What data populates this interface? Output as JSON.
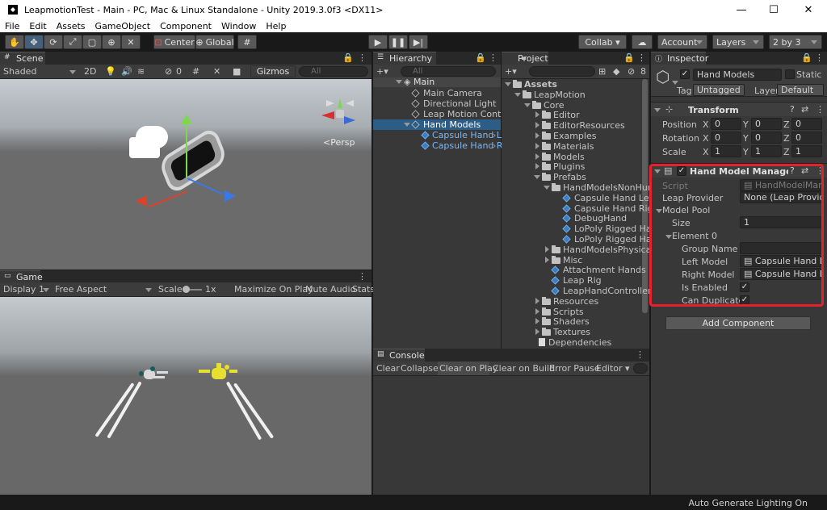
{
  "window": {
    "title": "LeapmotionTest - Main - PC, Mac & Linux Standalone - Unity 2019.3.0f3 <DX11>",
    "minimize": "—",
    "maximize": "☐",
    "close": "✕"
  },
  "menu": [
    "File",
    "Edit",
    "Assets",
    "GameObject",
    "Component",
    "Window",
    "Help"
  ],
  "toolbar": {
    "center": "Center",
    "global": "Global",
    "collab": "Collab ▾",
    "account": "Account",
    "layers": "Layers",
    "layout": "2 by 3"
  },
  "scene": {
    "tab": "Scene",
    "shading": "Shaded",
    "mode2d": "2D",
    "fx_count": "0",
    "gizmos": "Gizmos",
    "search_placeholder": "All",
    "persp": "<Persp"
  },
  "game": {
    "tab": "Game",
    "display": "Display 1",
    "aspect": "Free Aspect",
    "scale_label": "Scale",
    "scale_value": "1x",
    "maximize": "Maximize On Play",
    "mute": "Mute Audio",
    "stats": "Stats"
  },
  "hierarchy": {
    "tab": "Hierarchy",
    "add": "+▾",
    "search_placeholder": "All",
    "items": [
      {
        "label": "Main"
      },
      {
        "label": "Main Camera"
      },
      {
        "label": "Directional Light"
      },
      {
        "label": "Leap Motion Controlle"
      },
      {
        "label": "Hand Models"
      },
      {
        "label": "Capsule Hand Le"
      },
      {
        "label": "Capsule Hand R"
      }
    ]
  },
  "project": {
    "tab": "Project",
    "add": "+▾",
    "hidden_count": "8",
    "items": [
      {
        "label": "Assets"
      },
      {
        "label": "LeapMotion"
      },
      {
        "label": "Core"
      },
      {
        "label": "Editor"
      },
      {
        "label": "EditorResources"
      },
      {
        "label": "Examples"
      },
      {
        "label": "Materials"
      },
      {
        "label": "Models"
      },
      {
        "label": "Plugins"
      },
      {
        "label": "Prefabs"
      },
      {
        "label": "HandModelsNonHuma"
      },
      {
        "label": "Capsule Hand Left"
      },
      {
        "label": "Capsule Hand Right"
      },
      {
        "label": "DebugHand"
      },
      {
        "label": "LoPoly Rigged Hand"
      },
      {
        "label": "LoPoly Rigged Hand"
      },
      {
        "label": "HandModelsPhysical"
      },
      {
        "label": "Misc"
      },
      {
        "label": "Attachment Hands"
      },
      {
        "label": "Leap Rig"
      },
      {
        "label": "LeapHandController"
      },
      {
        "label": "Resources"
      },
      {
        "label": "Scripts"
      },
      {
        "label": "Shaders"
      },
      {
        "label": "Textures"
      },
      {
        "label": "Dependencies"
      }
    ]
  },
  "console": {
    "tab": "Console",
    "buttons": [
      "Clear",
      "Collapse",
      "Clear on Play",
      "Clear on Build",
      "Error Pause",
      "Editor ▾"
    ]
  },
  "inspector": {
    "tab": "Inspector",
    "object_name": "Hand Models",
    "static_label": "Static",
    "tag_label": "Tag",
    "tag_value": "Untagged",
    "layer_label": "Layer",
    "layer_value": "Default",
    "transform": {
      "title": "Transform",
      "position_label": "Position",
      "rotation_label": "Rotation",
      "scale_label": "Scale",
      "x": "X",
      "y": "Y",
      "z": "Z",
      "position": [
        "0",
        "0",
        "0"
      ],
      "rotation": [
        "0",
        "0",
        "0"
      ],
      "scale": [
        "1",
        "1",
        "1"
      ]
    },
    "component": {
      "title": "Hand Model Manager (Sc",
      "script_label": "Script",
      "script_value": "HandModelMana",
      "leap_provider_label": "Leap Provider",
      "leap_provider_value": "None (Leap Provide",
      "model_pool_label": "Model Pool",
      "size_label": "Size",
      "size_value": "1",
      "element_label": "Element 0",
      "group_name_label": "Group Name",
      "group_name_value": "",
      "left_model_label": "Left Model",
      "left_model_value": "Capsule Hand Le",
      "right_model_label": "Right Model",
      "right_model_value": "Capsule Hand Rig",
      "is_enabled_label": "Is Enabled",
      "can_duplicate_label": "Can Duplicate",
      "check": "✓"
    },
    "add_component": "Add Component"
  },
  "status": {
    "text": "Auto Generate Lighting On"
  },
  "colors": {
    "highlight_box": "#e8202a",
    "selection": "#2c5d87",
    "prefab_text": "#7cb8f5"
  }
}
